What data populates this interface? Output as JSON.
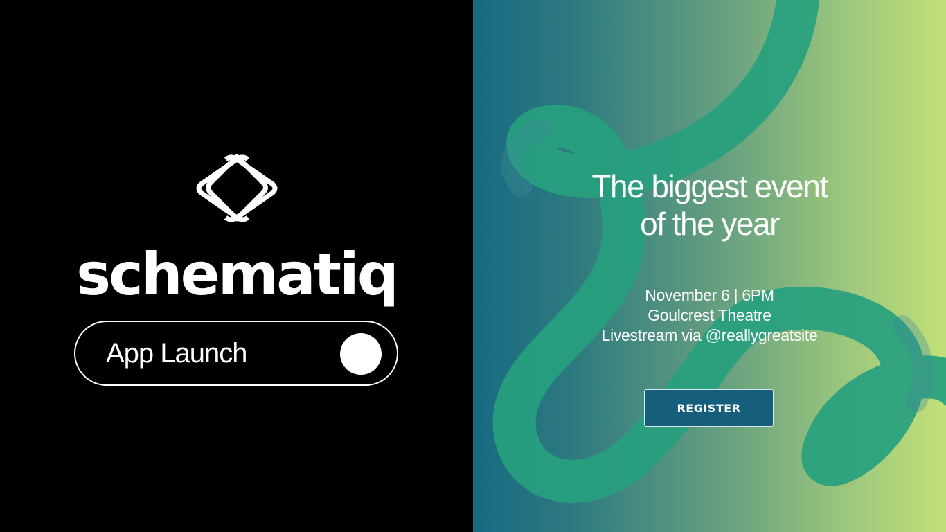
{
  "brand": {
    "name": "schematiq",
    "logo_icon": "interlocked-diamond-logo-icon"
  },
  "launch": {
    "label": "App Launch",
    "toggle_icon": "toggle-knob"
  },
  "event": {
    "headline_lines": [
      "The biggest event",
      "of the year"
    ],
    "date_time": "November 6 | 6PM",
    "venue": "Goulcrest Theatre",
    "livestream": "Livestream via @reallygreatsite",
    "register_label": "REGISTER"
  },
  "colors": {
    "left_background": "#000000",
    "gradient_start": "#166a82",
    "gradient_end": "#c2e07a",
    "swirl": "#2aa07f",
    "button": "#155f7c"
  }
}
